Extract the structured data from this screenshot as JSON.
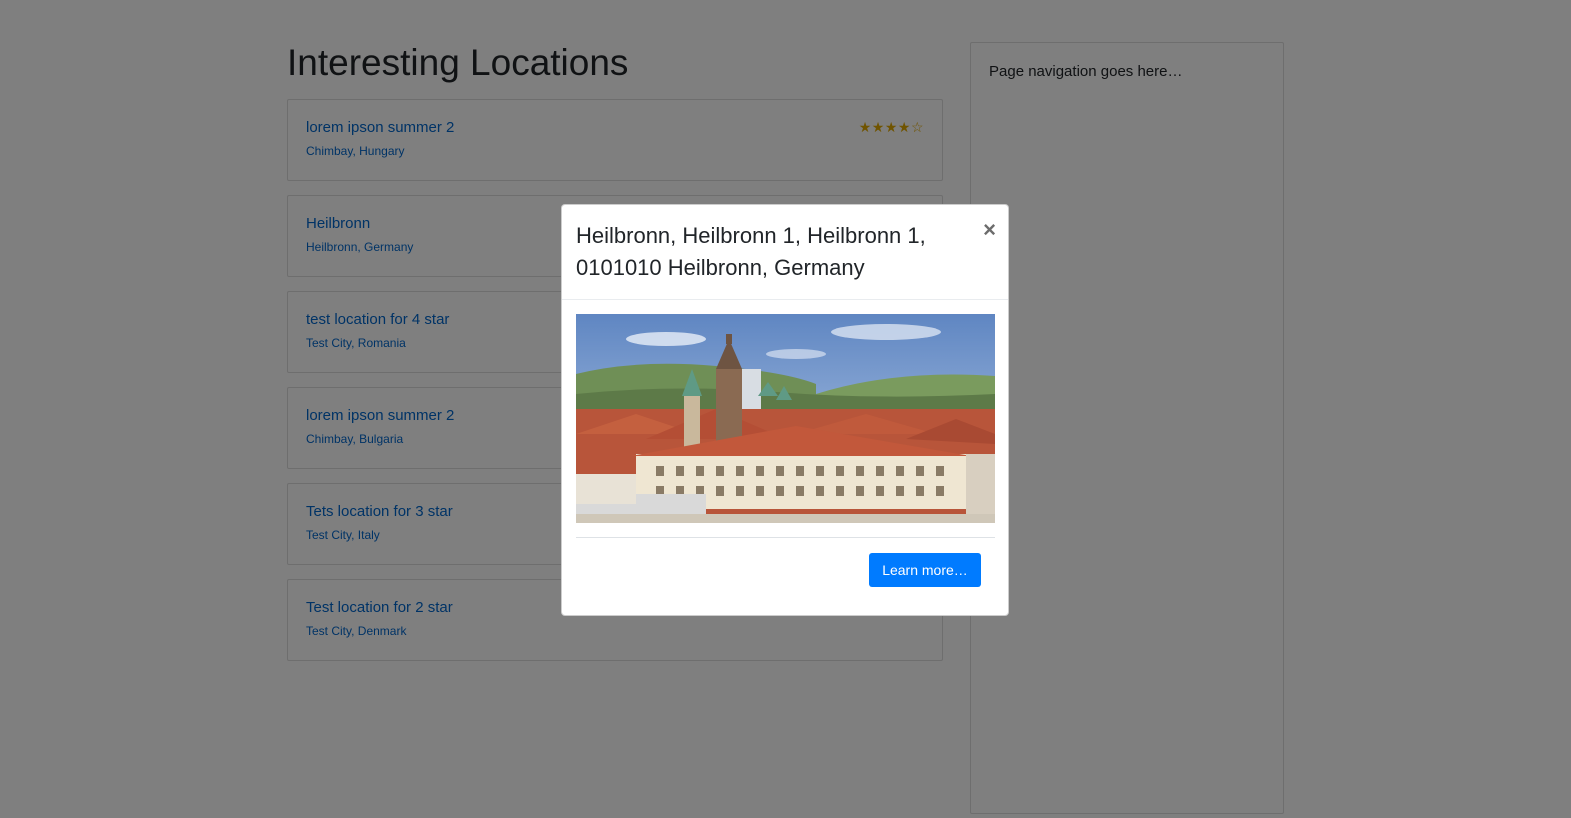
{
  "page": {
    "title": "Interesting Locations"
  },
  "locations": [
    {
      "name": "lorem ipson summer 2",
      "place": "Chimbay, Hungary",
      "stars": "★★★★☆"
    },
    {
      "name": "Heilbronn",
      "place": "Heilbronn, Germany",
      "stars": ""
    },
    {
      "name": "test location for 4 star",
      "place": "Test City, Romania",
      "stars": ""
    },
    {
      "name": "lorem ipson summer 2",
      "place": "Chimbay, Bulgaria",
      "stars": ""
    },
    {
      "name": "Tets location for 3 star",
      "place": "Test City, Italy",
      "stars": ""
    },
    {
      "name": "Test location for 2 star",
      "place": "Test City, Denmark",
      "stars": ""
    }
  ],
  "rating": {
    "first_location_value": 4,
    "max": 5
  },
  "sidebar": {
    "text": "Page navigation goes here…"
  },
  "modal": {
    "title": "Heilbronn, Heilbronn 1, Heilbronn 1, 0101010 Heilbronn, Germany",
    "close_label": "×",
    "image_alt": "Heilbronn city view",
    "button_label": "Learn more…"
  },
  "colors": {
    "link": "#0066cc",
    "star": "#e0a800",
    "primary_button": "#007bff",
    "backdrop": "rgba(0,0,0,0.5)"
  }
}
